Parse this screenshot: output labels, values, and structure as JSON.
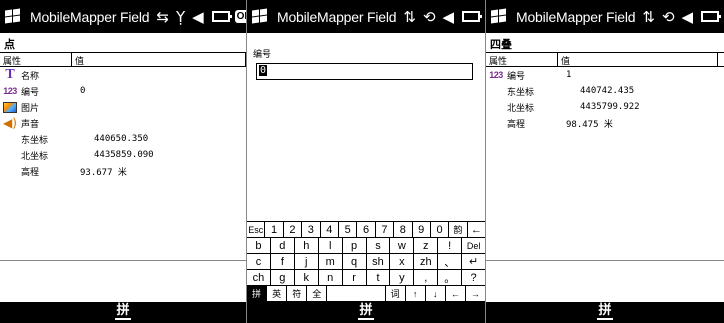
{
  "app_title": "MobileMapper Field",
  "ok_label": "OK",
  "ime_label": "拼",
  "screen1": {
    "heading": "点",
    "columns": [
      "属性",
      "值"
    ],
    "rows": [
      {
        "icon": "text-field-icon",
        "label": "名称",
        "value": ""
      },
      {
        "icon": "number-field-icon",
        "label": "编号",
        "value": "0"
      },
      {
        "icon": "image-field-icon",
        "label": "图片",
        "value": ""
      },
      {
        "icon": "audio-field-icon",
        "label": "声音",
        "value": ""
      },
      {
        "icon": "",
        "label": "东坐标",
        "value": "440650.350"
      },
      {
        "icon": "",
        "label": "北坐标",
        "value": "4435859.090"
      },
      {
        "icon": "",
        "label": "高程",
        "value": "93.677 米"
      }
    ]
  },
  "screen2": {
    "field_label": "编号",
    "field_value": "0",
    "keyboard": {
      "row1": [
        "Esc",
        "1",
        "2",
        "3",
        "4",
        "5",
        "6",
        "7",
        "8",
        "9",
        "0",
        "韵",
        "←"
      ],
      "row2": [
        "b",
        "d",
        "h",
        "l",
        "p",
        "s",
        "w",
        "z",
        "!",
        "Del"
      ],
      "row3": [
        "c",
        "f",
        "j",
        "m",
        "q",
        "sh",
        "x",
        "zh",
        "、",
        "↵"
      ],
      "row4": [
        "ch",
        "g",
        "k",
        "n",
        "r",
        "t",
        "y",
        ",",
        "。",
        "?"
      ],
      "row5": [
        "拼",
        "英",
        "符",
        "全",
        "",
        "词",
        "↑",
        "↓",
        "←",
        "→"
      ]
    }
  },
  "screen3": {
    "heading": "四叠",
    "columns": [
      "属性",
      "值"
    ],
    "rows": [
      {
        "icon": "number-field-icon",
        "label": "编号",
        "value": "1"
      },
      {
        "icon": "",
        "label": "东坐标",
        "value": "440742.435"
      },
      {
        "icon": "",
        "label": "北坐标",
        "value": "4435799.922"
      },
      {
        "icon": "",
        "label": "高程",
        "value": "98.475 米"
      }
    ]
  },
  "icons": {
    "number": "123",
    "text": "T",
    "status": [
      "⇄",
      "Y",
      "◀"
    ]
  },
  "colors": {
    "bar": "#000000",
    "number_icon": "#7a2f8f",
    "text_icon": "#6a2fb5",
    "audio_icon": "#d07000"
  }
}
